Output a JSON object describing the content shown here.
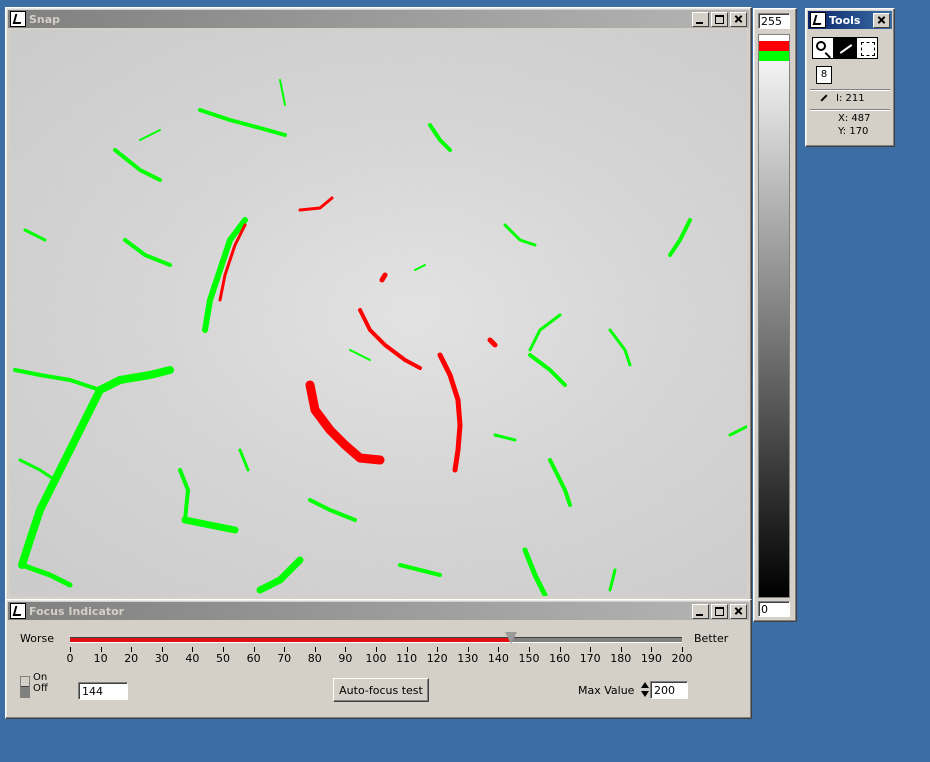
{
  "snap_window": {
    "title": "Snap"
  },
  "intensity_bar": {
    "max_value": "255",
    "min_value": "0",
    "marker_colors": [
      "#ff0000",
      "#00ff00"
    ]
  },
  "tools_window": {
    "title": "Tools",
    "small_tool_label": "8",
    "intensity_readout": "I: 211",
    "x_readout": "X: 487",
    "y_readout": "Y: 170",
    "tools": [
      "magnifier-icon",
      "magic-wand-icon",
      "marquee-select-icon"
    ]
  },
  "focus_window": {
    "title": "Focus Indicator",
    "worse_label": "Worse",
    "better_label": "Better",
    "scale_min": 0,
    "scale_max": 200,
    "current_focus": 144,
    "ticks": [
      "0",
      "10",
      "20",
      "30",
      "40",
      "50",
      "60",
      "70",
      "80",
      "90",
      "100",
      "110",
      "120",
      "130",
      "140",
      "150",
      "160",
      "170",
      "180",
      "190",
      "200"
    ],
    "on_label": "On",
    "off_label": "Off",
    "focus_value_field": "144",
    "autofocus_button": "Auto-focus test",
    "max_value_label": "Max Value",
    "max_value_field": "200"
  },
  "colors": {
    "desktop": "#3a6ea5",
    "window": "#d4d0c8",
    "crack_red": "#ff0000",
    "crack_green": "#00ff00"
  }
}
